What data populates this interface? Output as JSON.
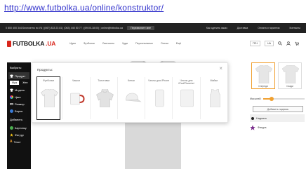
{
  "browser": {
    "link_text": "http://www.futbolka.ua/online/konstruktor/"
  },
  "topbar": {
    "contacts": "0 800 400 344 Бесплатно по УА  |  (067) 833 23 81  |  (063) 440 50 77  |  (09:00-18:00)  |  online@futbolka.ua",
    "callback": "Перезвоните мне",
    "links": [
      "Как сделать заказ",
      "Доставка",
      "Оплата и гарантии",
      "Контакты"
    ]
  },
  "header": {
    "logo_text": "FUTBOLKA",
    "logo_suffix": ".UA",
    "nav": [
      "Идеи",
      "Футболки",
      "Свитшоты",
      "Худи",
      "Персональные",
      "Оптом",
      "Ещё"
    ],
    "lang": "UA",
    "currency": "ГРН"
  },
  "sidebar": {
    "title": "Выбрать:",
    "product_item": "Продукт",
    "segments": [
      "Муж",
      "Жен"
    ],
    "items": [
      "Модель",
      "Цвет",
      "Размер",
      "Бирка"
    ],
    "add_title": "Добавить:",
    "add_items": [
      "Картинку",
      "Фигуру",
      "Текст"
    ]
  },
  "modal": {
    "title": "Продукты:",
    "close": "×",
    "products": [
      {
        "label": "Футболки",
        "selected": true
      },
      {
        "label": "Чашки",
        "selected": false
      },
      {
        "label": "Толстовки",
        "selected": false
      },
      {
        "label": "Кепки",
        "selected": false
      },
      {
        "label": "Чехлы для iPhone",
        "selected": false
      },
      {
        "label": "Чехлы для iPad/Planshet",
        "selected": false
      },
      {
        "label": "Майки",
        "selected": false
      }
    ]
  },
  "right_panel": {
    "thumbs": [
      "Спереди",
      "Сзади"
    ],
    "size_label": "Масштаб:",
    "size_value_fraction": 0.2,
    "add_text_button": "Добавить надпись",
    "layers": [
      {
        "label": "Надпись",
        "icon": "circle-icon",
        "color": "#222222"
      },
      {
        "label": "Фигура",
        "icon": "star-icon",
        "color": "#7a2d8c"
      }
    ]
  },
  "colors": {
    "accent": "#d9261c",
    "slider": "#f0a030",
    "sidebar_bg": "#111111"
  }
}
